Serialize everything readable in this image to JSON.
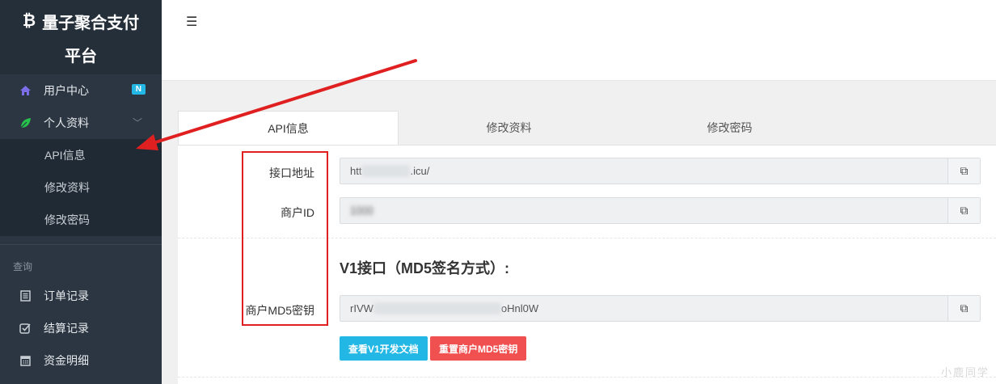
{
  "brand": {
    "logo": "₿",
    "line1": "量子聚合支付",
    "line2": "平台"
  },
  "sidebar": {
    "items": [
      {
        "label": "用户中心",
        "icon": "home-icon",
        "badge": "N"
      },
      {
        "label": "个人资料",
        "icon": "leaf-icon",
        "chevron": "﹀"
      }
    ],
    "submenu": [
      "API信息",
      "修改资料",
      "修改密码"
    ],
    "section": "查询",
    "query_items": [
      {
        "label": "订单记录",
        "icon": "list-icon"
      },
      {
        "label": "结算记录",
        "icon": "check-square-icon"
      },
      {
        "label": "资金明细",
        "icon": "calendar-icon"
      }
    ]
  },
  "header": {
    "toggle": "☰"
  },
  "tabs": [
    "API信息",
    "修改资料",
    "修改密码"
  ],
  "form": {
    "api_label": "接口地址",
    "api_prefix": "htt",
    "api_suffix": ".icu/",
    "mid_label": "商户ID",
    "mid_value": "1000",
    "v1_title": "V1接口（MD5签名方式）:",
    "md5_label": "商户MD5密钥",
    "md5_prefix": "rIVW",
    "md5_suffix": "oHnl0W",
    "copy_icon": "⧉"
  },
  "buttons": {
    "docs": "查看V1开发文档",
    "reset": "重置商户MD5密钥"
  },
  "watermark": "小鹿同学",
  "colors": {
    "sidebar": "#2b3642",
    "accent": "#23b7e5",
    "danger": "#f05050",
    "annotation": "#e02020"
  }
}
